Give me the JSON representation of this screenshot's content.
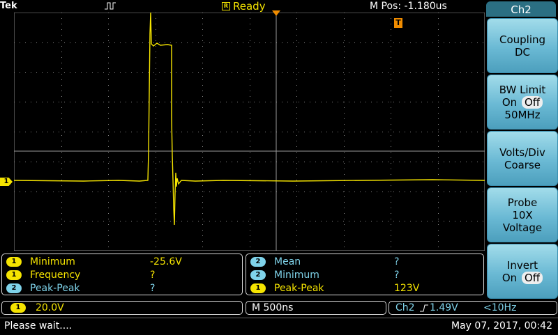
{
  "top": {
    "brand": "Tek",
    "status": "Ready",
    "m_pos": "M Pos: -1.180us"
  },
  "side_menu": {
    "title": "Ch2",
    "coupling": {
      "label": "Coupling",
      "value": "DC"
    },
    "bw_limit": {
      "label": "BW Limit",
      "on": "On",
      "off": "Off",
      "freq": "50MHz"
    },
    "volts_div": {
      "label": "Volts/Div",
      "value": "Coarse"
    },
    "probe": {
      "label": "Probe",
      "atten": "10X",
      "type": "Voltage"
    },
    "invert": {
      "label": "Invert",
      "on": "On",
      "off": "Off"
    }
  },
  "measurements_left": [
    {
      "ch": "1",
      "name": "Minimum",
      "value": "-25.6V",
      "color": "yellow"
    },
    {
      "ch": "1",
      "name": "Frequency",
      "value": "?",
      "color": "yellow"
    },
    {
      "ch": "2",
      "name": "Peak-Peak",
      "value": "?",
      "color": "blue"
    }
  ],
  "measurements_right": [
    {
      "ch": "2",
      "name": "Mean",
      "value": "?",
      "color": "blue"
    },
    {
      "ch": "2",
      "name": "Minimum",
      "value": "?",
      "color": "blue"
    },
    {
      "ch": "1",
      "name": "Peak-Peak",
      "value": "123V",
      "color": "yellow"
    }
  ],
  "status_bar": {
    "ch1_badge": "1",
    "ch1_scale": "20.0V",
    "timebase": "M 500ns",
    "trigger_src": "Ch2",
    "trigger_level": "1.49V",
    "trigger_freq": "<10Hz"
  },
  "bottom": {
    "message": "Please wait....",
    "datetime": "May 07, 2017, 00:42"
  },
  "markers": {
    "ch1_ground": "1",
    "trigger_T": "T"
  },
  "colors": {
    "ch1": "#f5e400",
    "ch2": "#7fd3ea",
    "menu_accent": "#2b6f83",
    "trigger_marker": "#f08c00"
  }
}
